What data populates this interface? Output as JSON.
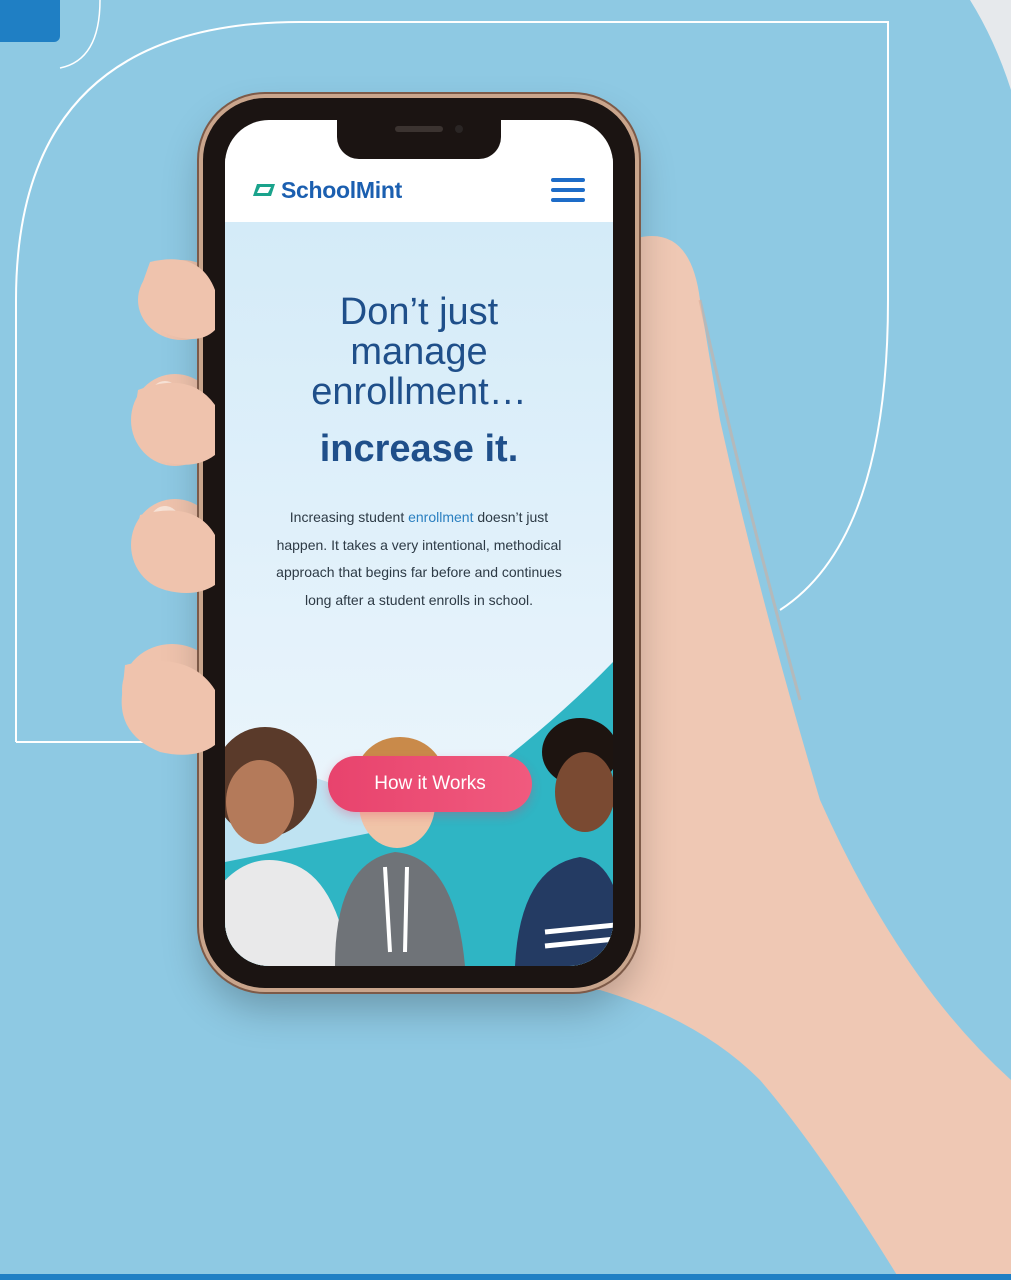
{
  "page": {
    "background_color": "#8ec9e3",
    "accent_color": "#1f7fc4"
  },
  "site": {
    "logo_text": "SchoolMint",
    "logo_color": "#1b5fb0",
    "menu_icon": "hamburger-menu-icon"
  },
  "hero": {
    "heading_lines": [
      "Don’t just",
      "manage",
      "enrollment…"
    ],
    "heading_emphasis": "increase it.",
    "body_before": "Increasing student ",
    "body_highlight": "enrollment",
    "body_after": " doesn’t just happen. It takes a very intentional, methodical approach that begins far before and continues long after a student enrolls in school.",
    "cta_label": "How it Works",
    "cta_color": "#e8436d",
    "heading_color": "#1f4f8a"
  }
}
